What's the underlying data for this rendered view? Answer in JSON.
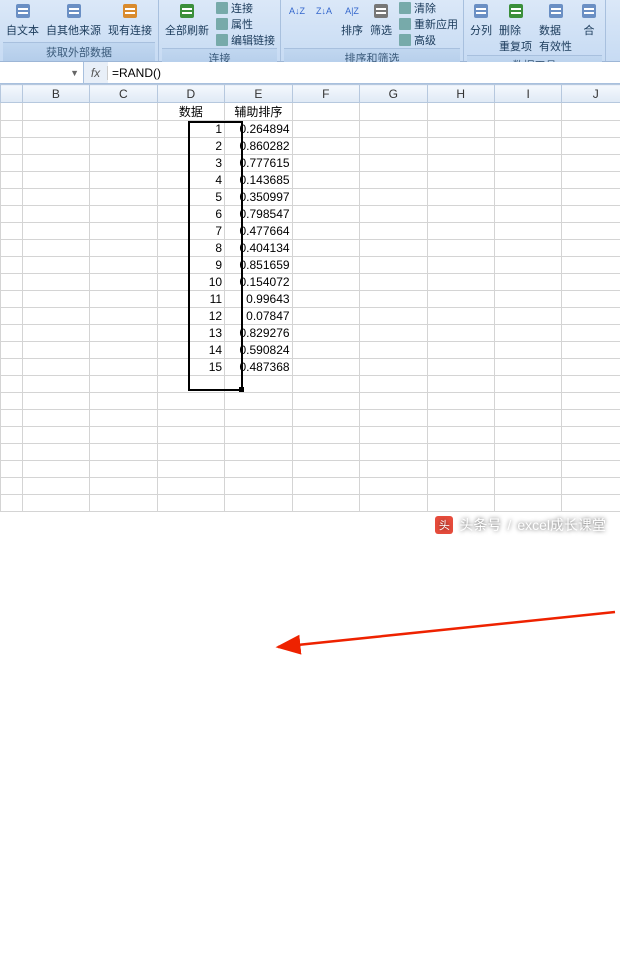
{
  "ribbon": {
    "groups": [
      {
        "label": "获取外部数据",
        "buttons": [
          {
            "name": "from-text",
            "label": "自文本",
            "iconColor": "#6a8fc4"
          },
          {
            "name": "from-other",
            "label": "自其他来源",
            "iconColor": "#6a8fc4"
          },
          {
            "name": "existing-conn",
            "label": "现有连接",
            "iconColor": "#d98b2e"
          }
        ]
      },
      {
        "label": "连接",
        "buttons": [
          {
            "name": "refresh-all",
            "label": "全部刷新",
            "iconColor": "#3b8f3b"
          }
        ],
        "small": [
          {
            "name": "connections",
            "label": "连接"
          },
          {
            "name": "properties",
            "label": "属性"
          },
          {
            "name": "edit-links",
            "label": "编辑链接"
          }
        ]
      },
      {
        "label": "排序和筛选",
        "buttons": [
          {
            "name": "sort-asc",
            "label": "",
            "iconText": "A↓Z"
          },
          {
            "name": "sort-desc",
            "label": "",
            "iconText": "Z↓A"
          },
          {
            "name": "sort",
            "label": "排序",
            "iconText": "A|Z"
          },
          {
            "name": "filter",
            "label": "筛选",
            "iconColor": "#777"
          }
        ],
        "small": [
          {
            "name": "clear",
            "label": "清除"
          },
          {
            "name": "reapply",
            "label": "重新应用"
          },
          {
            "name": "advanced",
            "label": "高级"
          }
        ]
      },
      {
        "label": "数据工具",
        "buttons": [
          {
            "name": "text-to-col",
            "label": "分列",
            "iconColor": "#6a8fc4"
          },
          {
            "name": "remove-dup",
            "label": "删除\n重复项",
            "iconColor": "#3b8f3b"
          },
          {
            "name": "data-valid",
            "label": "数据\n有效性",
            "iconColor": "#6a8fc4"
          },
          {
            "name": "consolidate",
            "label": "合",
            "iconColor": "#6a8fc4"
          }
        ]
      }
    ]
  },
  "namebox": {
    "value": ""
  },
  "fx_label": "fx",
  "formula": "=RAND()",
  "columns": [
    "B",
    "C",
    "D",
    "E",
    "F",
    "G",
    "H",
    "I",
    "J"
  ],
  "headers": {
    "D": "数据",
    "E": "辅助排序"
  },
  "rows": [
    {
      "d": "1",
      "e": "0.264894"
    },
    {
      "d": "2",
      "e": "0.860282"
    },
    {
      "d": "3",
      "e": "0.777615"
    },
    {
      "d": "4",
      "e": "0.143685"
    },
    {
      "d": "5",
      "e": "0.350997"
    },
    {
      "d": "6",
      "e": "0.798547"
    },
    {
      "d": "7",
      "e": "0.477664"
    },
    {
      "d": "8",
      "e": "0.404134"
    },
    {
      "d": "9",
      "e": "0.851659"
    },
    {
      "d": "10",
      "e": "0.154072"
    },
    {
      "d": "11",
      "e": "0.99643"
    },
    {
      "d": "12",
      "e": "0.07847"
    },
    {
      "d": "13",
      "e": "0.829276"
    },
    {
      "d": "14",
      "e": "0.590824"
    },
    {
      "d": "15",
      "e": "0.487368"
    }
  ],
  "empty_rows_after": 8,
  "watermark": {
    "prefix": "头条号",
    "sep": "/",
    "name": "excel成长课堂"
  },
  "chart_data": {
    "type": "table",
    "title": "辅助排序",
    "categories": [
      "1",
      "2",
      "3",
      "4",
      "5",
      "6",
      "7",
      "8",
      "9",
      "10",
      "11",
      "12",
      "13",
      "14",
      "15"
    ],
    "values": [
      0.264894,
      0.860282,
      0.777615,
      0.143685,
      0.350997,
      0.798547,
      0.477664,
      0.404134,
      0.851659,
      0.154072,
      0.99643,
      0.07847,
      0.829276,
      0.590824,
      0.487368
    ]
  }
}
